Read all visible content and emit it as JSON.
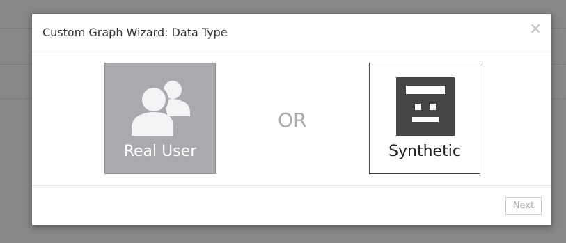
{
  "modal": {
    "title": "Custom Graph Wizard: Data Type",
    "close_glyph": "×"
  },
  "options": {
    "real_user": {
      "label": "Real User",
      "icon": "users-icon",
      "selected": true,
      "bg_color": "#a9aaad"
    },
    "separator": "OR",
    "synthetic": {
      "label": "Synthetic",
      "icon": "robot-icon",
      "selected": false,
      "icon_color": "#444444"
    }
  },
  "footer": {
    "next_label": "Next",
    "next_enabled": false
  }
}
